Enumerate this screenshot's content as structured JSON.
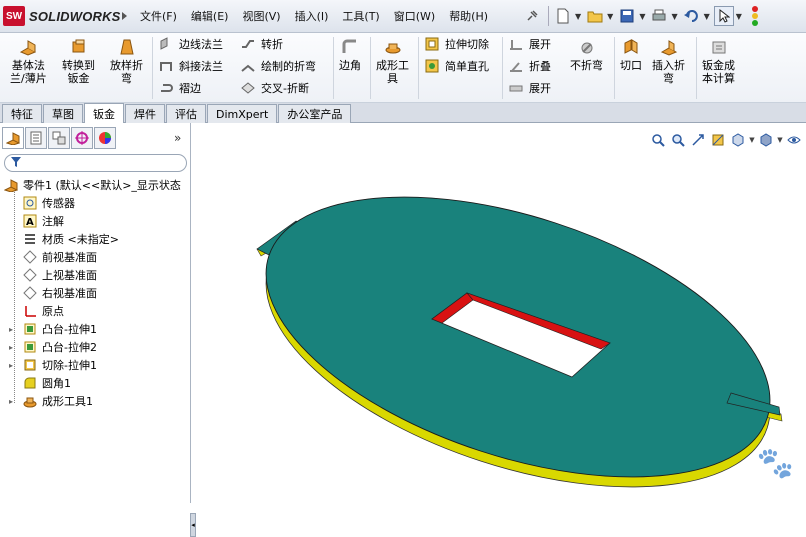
{
  "app": {
    "logo_badge": "SW",
    "logo_text": "SOLIDWORKS",
    "menu": [
      "文件(F)",
      "编辑(E)",
      "视图(V)",
      "插入(I)",
      "工具(T)",
      "窗口(W)",
      "帮助(H)"
    ],
    "toolbar_icons": [
      "pin-icon",
      "new-document-icon",
      "open-folder-icon",
      "save-icon",
      "print-icon",
      "undo-icon",
      "select-pointer-icon",
      "rebuild-traffic-light-icon"
    ]
  },
  "ribbon": {
    "big_buttons": [
      {
        "label": "基体法\n兰/薄片",
        "icon": "base-flange-icon"
      },
      {
        "label": "转换到\n钣金",
        "icon": "convert-to-sheetmetal-icon"
      },
      {
        "label": "放样折\n弯",
        "icon": "lofted-bend-icon"
      }
    ],
    "col1": [
      "边线法兰",
      "斜接法兰",
      "褶边"
    ],
    "col2": [
      "转折",
      "绘制的折弯",
      "交叉-折断"
    ],
    "corner": "边角",
    "forming_tool": "成形工\n具",
    "col3": [
      "拉伸切除",
      "简单直孔"
    ],
    "col4": [
      "展开",
      "折叠",
      "展开"
    ],
    "no_bend": "不折弯",
    "cut": "切口",
    "insert_bend": "插入折\n弯",
    "cost": "钣金成\n本计算"
  },
  "tabs": [
    "特征",
    "草图",
    "钣金",
    "焊件",
    "评估",
    "DimXpert",
    "办公室产品"
  ],
  "active_tab": "钣金",
  "feature_tree": {
    "root": "零件1 (默认<<默认>_显示状态",
    "items": [
      {
        "label": "传感器",
        "icon": "sensor-icon",
        "expandable": false
      },
      {
        "label": "注解",
        "icon": "annotation-icon",
        "expandable": false
      },
      {
        "label": "材质 <未指定>",
        "icon": "material-icon",
        "expandable": false
      },
      {
        "label": "前视基准面",
        "icon": "plane-icon",
        "expandable": false
      },
      {
        "label": "上视基准面",
        "icon": "plane-icon",
        "expandable": false
      },
      {
        "label": "右视基准面",
        "icon": "plane-icon",
        "expandable": false
      },
      {
        "label": "原点",
        "icon": "origin-icon",
        "expandable": false
      },
      {
        "label": "凸台-拉伸1",
        "icon": "boss-extrude-icon",
        "expandable": true
      },
      {
        "label": "凸台-拉伸2",
        "icon": "boss-extrude-icon",
        "expandable": true
      },
      {
        "label": "切除-拉伸1",
        "icon": "cut-extrude-icon",
        "expandable": true
      },
      {
        "label": "圆角1",
        "icon": "fillet-icon",
        "expandable": false
      },
      {
        "label": "成形工具1",
        "icon": "forming-tool-icon",
        "expandable": true
      }
    ]
  },
  "colors": {
    "part_top": "#19827c",
    "part_edge": "#d9d800",
    "cut_wall": "#d81212",
    "accent": "#2c5aa0"
  }
}
